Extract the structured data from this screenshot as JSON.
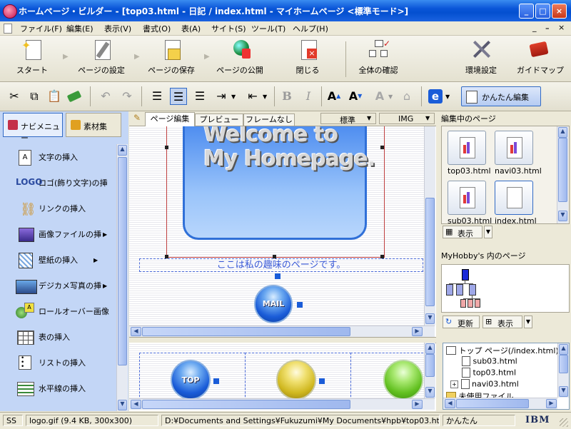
{
  "window": {
    "title": "ホームページ・ビルダー - [top03.html - 日記 / index.html - マイホームページ <標準モード>]",
    "min": "_",
    "max": "□",
    "close": "×"
  },
  "menu": {
    "items": [
      "ファイル(F)",
      "編集(E)",
      "表示(V)",
      "書式(O)",
      "表(A)",
      "サイト(S)",
      "ツール(T)",
      "ヘルプ(H)"
    ],
    "right_controls": [
      "_",
      "ｰ",
      "×"
    ]
  },
  "big_toolbar": {
    "start": "スタート",
    "page_settings": "ページの設定",
    "save_page": "ページの保存",
    "publish": "ページの公開",
    "close": "閉じる",
    "check_all": "全体の確認",
    "env_settings": "環境設定",
    "guide_map": "ガイドマップ"
  },
  "small_toolbar": {
    "easy_edit": "かんたん編集",
    "bold": "B",
    "italic": "I"
  },
  "left_panel": {
    "tab_navi": "ナビメニュー",
    "tab_material": "素材集",
    "items": [
      "文字の挿入",
      "ロゴ(飾り文字)の挿",
      "リンクの挿入",
      "画像ファイルの挿",
      "壁紙の挿入",
      "デジカメ写真の挿",
      "ロールオーバー画像",
      "表の挿入",
      "リストの挿入",
      "水平線の挿入"
    ]
  },
  "editor": {
    "tab_edit": "ページ編集",
    "tab_preview": "プレビュー",
    "tab_noframe": "フレームなし",
    "style_select": "標準",
    "img_select": "IMG",
    "welcome_line1": "Welcome to",
    "welcome_line2": "My Homepage.",
    "subtitle": "ここは私の趣味のページです。",
    "mail_label": "MAIL",
    "top_label": "TOP"
  },
  "right_panel": {
    "editing_title": "編集中のページ",
    "files": [
      "top03.html",
      "navi03.html",
      "sub03.html",
      "index.html"
    ],
    "show_button": "表示",
    "site_title": "MyHobby's 内のページ",
    "refresh_button": "更新",
    "show_button2": "表示",
    "tree": [
      "トップ ページ(/index.html)",
      "sub03.html",
      "top03.html",
      "navi03.html",
      "未使用ファイル"
    ]
  },
  "status": {
    "mode": "SS",
    "file_info": "logo.gif (9.4 KB, 300x300)",
    "path": "D:¥Documents and Settings¥Fukuzumi¥My Documents¥hpb¥top03.html",
    "edit_mode": "かんたん",
    "brand": "IBM"
  },
  "colors": {
    "accent": "#0a55d8",
    "panel": "#c3d6f6",
    "button_blue": "#1a5cd8",
    "button_yellow": "#e8d43a",
    "button_green": "#72d02a"
  }
}
